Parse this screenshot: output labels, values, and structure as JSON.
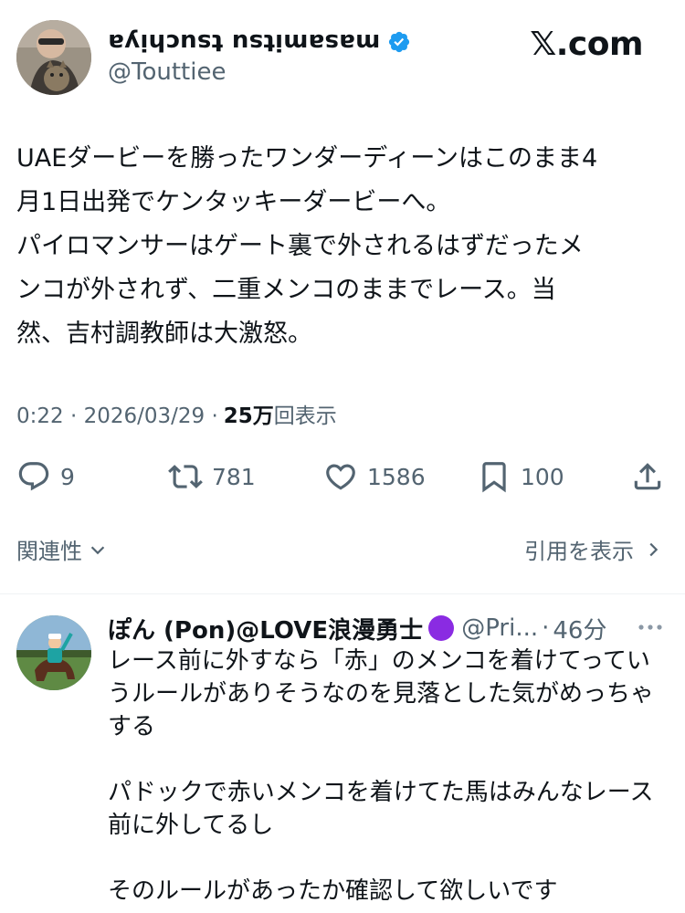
{
  "author": {
    "display_name": "masamitsu tsuchiya",
    "handle": "@Touttiee"
  },
  "brand": {
    "logo_text": ".com",
    "logo_glyph": "𝕏"
  },
  "tweet": {
    "text": "UAEダービーを勝ったワンダーディーンはこのまま4\n月1日出発でケンタッキーダービーへ。\nパイロマンサーはゲート裏で外されるはずだったメ\nンコが外されず、二重メンコのままでレース。当\n然、吉村調教師は大激怒。",
    "timestamp": "0:22 · 2026/03/29 · ",
    "views_count": "25万",
    "views_label": "回表示"
  },
  "actions": {
    "reply_count": "9",
    "retweet_count": "781",
    "like_count": "1586",
    "bookmark_count": "100"
  },
  "links": {
    "related": "関連性",
    "quotes": "引用を表示"
  },
  "reply": {
    "name": "ぽん (Pon)@LOVE浪漫勇士",
    "handle": "@Pri...",
    "separator": "·",
    "time": "46分",
    "paragraphs": [
      "レース前に外すなら「赤」のメンコを着けてってい\nうルールがありそうなのを見落とした気がめっちゃ\nする",
      "パドックで赤いメンコを着けてた馬はみんなレース\n前に外してるし",
      "そのルールがあったか確認して欲しいです"
    ]
  },
  "colors": {
    "text": "#0f1419",
    "secondary": "#536471",
    "verified": "#1d9bf0",
    "purple_badge": "#8a2be2",
    "divider": "#eff3f4"
  },
  "icons": {
    "verified": "verified-badge-icon",
    "reply": "reply-icon",
    "retweet": "retweet-icon",
    "like": "heart-icon",
    "bookmark": "bookmark-icon",
    "share": "share-icon",
    "more": "more-icon"
  }
}
